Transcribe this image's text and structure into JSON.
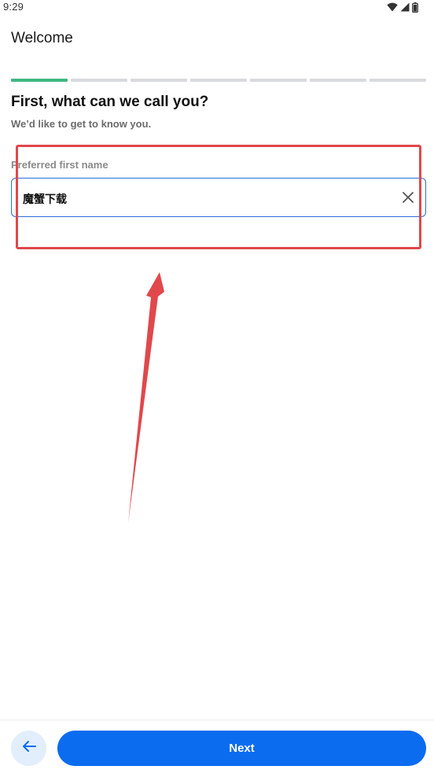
{
  "status_bar": {
    "time": "9:29",
    "icons": [
      "wifi-icon",
      "signal-icon",
      "battery-icon"
    ]
  },
  "header": {
    "title": "Welcome"
  },
  "progress": {
    "total_steps": 7,
    "completed_steps": 1,
    "done_color": "#41b883",
    "pending_color": "#d8dadd"
  },
  "form": {
    "heading": "First, what can we call you?",
    "subheading": "We’d like to get to know you.",
    "field_label": "Preferred first name",
    "field_value": "魔蟹下载",
    "clear_icon": "close-icon"
  },
  "footer": {
    "back_icon": "arrow-left-icon",
    "next_label": "Next",
    "accent_color": "#0b6cf0"
  },
  "annotation": {
    "color": "#e0484c"
  }
}
